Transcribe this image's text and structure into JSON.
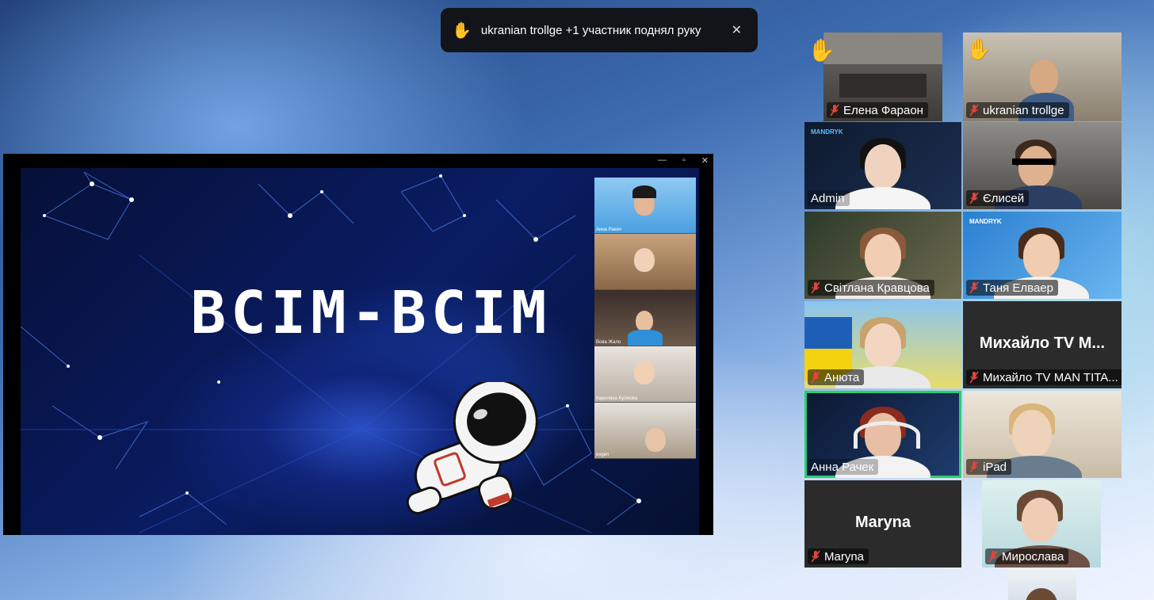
{
  "toast": {
    "icon": "raised-hand-icon",
    "message": "ukranian trollge +1 участник поднял руку",
    "close_icon": "close-icon"
  },
  "shared_screen": {
    "slide_title": "ВСІМ-ВСІМ",
    "window_controls": [
      "—",
      "▫",
      "✕"
    ],
    "mini_participants": [
      "Анна Ракеч",
      "",
      "Вова Жало",
      "Каролина Кулікова",
      "evgen"
    ]
  },
  "participants": [
    {
      "name": "Елена Фараон",
      "muted": true,
      "hand_raised": true
    },
    {
      "name": "ukranian trollge",
      "muted": true,
      "hand_raised": true
    },
    {
      "name": "Admin",
      "muted": false,
      "hand_raised": false
    },
    {
      "name": "Єлисей",
      "muted": true,
      "hand_raised": false
    },
    {
      "name": "Світлана Кравцова",
      "muted": true,
      "hand_raised": false
    },
    {
      "name": "Таня Елваер",
      "muted": true,
      "hand_raised": false
    },
    {
      "name": "Анюта",
      "muted": true,
      "hand_raised": false
    },
    {
      "name": "Михайло TV MAN TITA...",
      "display_text": "Михайло TV M...",
      "muted": true,
      "hand_raised": false
    },
    {
      "name": "Анна Рачек",
      "muted": false,
      "hand_raised": false,
      "active_speaker": true
    },
    {
      "name": "iPad",
      "muted": true,
      "hand_raised": false
    },
    {
      "name": "Maryna",
      "display_text": "Maryna",
      "muted": true,
      "hand_raised": false
    },
    {
      "name": "Мирослава",
      "muted": true,
      "hand_raised": false
    }
  ],
  "brand_label": "MANDRYK",
  "colors": {
    "active_speaker": "#2ecc71",
    "muted_icon": "#e0463c",
    "raised_hand": "#f3c54a",
    "toast_bg": "#12141a"
  }
}
